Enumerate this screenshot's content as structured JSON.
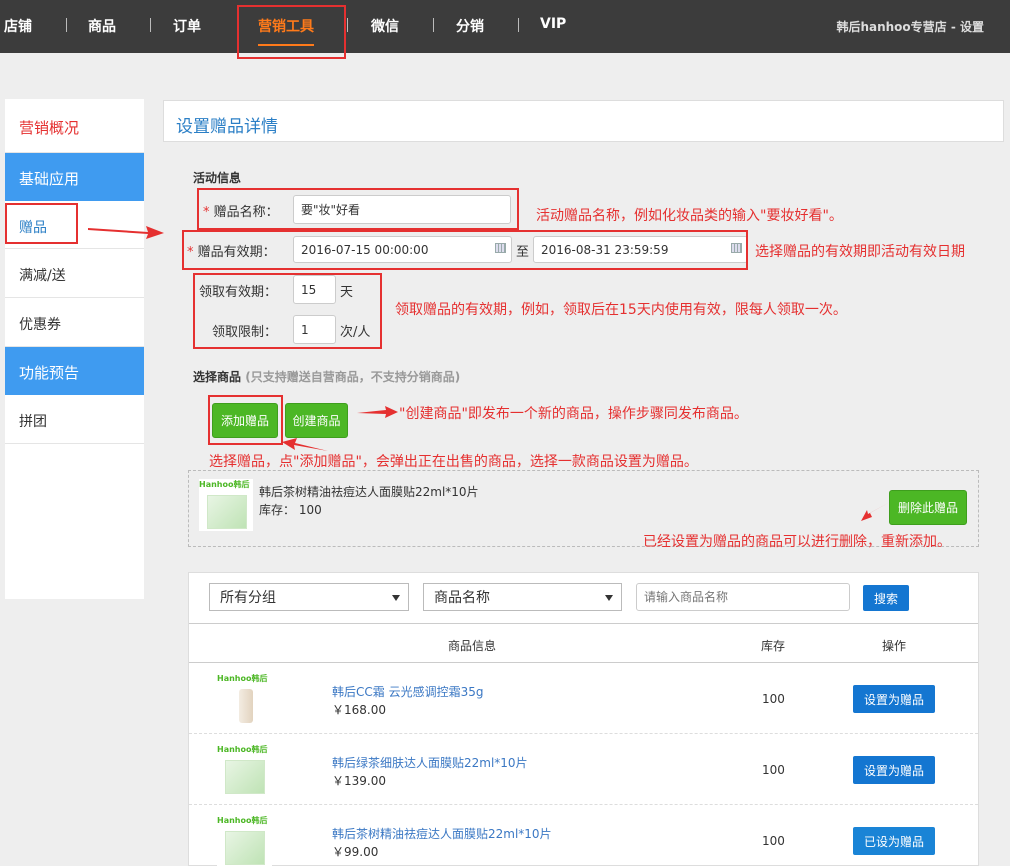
{
  "topnav": {
    "items": [
      "店铺",
      "商品",
      "订单",
      "营销工具",
      "微信",
      "分销",
      "VIP"
    ],
    "active": "营销工具",
    "store_info": "韩后hanhoo专营店 - 设置"
  },
  "sidebar": {
    "items": [
      "营销概况",
      "基础应用",
      "赠品",
      "满减/送",
      "优惠券",
      "功能预告",
      "拼团"
    ]
  },
  "page_title": "设置赠品详情",
  "activity": {
    "section_label": "活动信息",
    "gift_name_label": "赠品名称：",
    "gift_name_value": "要\"妆\"好看",
    "validity_label": "赠品有效期：",
    "start_date": "2016-07-15 00:00:00",
    "to": "至",
    "end_date": "2016-08-31 23:59:59",
    "claim_validity_label": "领取有效期：",
    "claim_validity_value": "15",
    "claim_validity_unit": "天",
    "claim_limit_label": "领取限制：",
    "claim_limit_value": "1",
    "claim_limit_unit": "次/人"
  },
  "select_goods": {
    "section_label": "选择商品",
    "hint": "(只支持赠送自营商品，不支持分销商品)",
    "add_button": "添加赠品",
    "create_button": "创建商品"
  },
  "selected_gift": {
    "name": "韩后茶树精油祛痘达人面膜贴22ml*10片",
    "stock_label": "库存：",
    "stock_value": "100",
    "delete_button": "删除此赠品",
    "brand": "Hanhoo韩后"
  },
  "annotations": {
    "a1": "活动赠品名称，例如化妆品类的输入\"要妆好看\"。",
    "a2": "选择赠品的有效期即活动有效日期",
    "a3": "领取赠品的有效期，例如，领取后在15天内使用有效，限每人领取一次。",
    "a4": "\"创建商品\"即发布一个新的商品，操作步骤同发布商品。",
    "a5": "选择赠品，点\"添加赠品\"，会弹出正在出售的商品，选择一款商品设置为赠品。",
    "a6": "已经设置为赠品的商品可以进行删除，重新添加。"
  },
  "filter": {
    "group_select": "所有分组",
    "field_select": "商品名称",
    "search_placeholder": "请输入商品名称",
    "search_button": "搜索"
  },
  "table": {
    "headers": [
      "商品信息",
      "库存",
      "操作"
    ],
    "rows": [
      {
        "name": "韩后CC霜 云光感调控霜35g",
        "price": "￥168.00",
        "stock": "100",
        "action": "设置为赠品",
        "brand": "Hanhoo韩后"
      },
      {
        "name": "韩后绿茶细肤达人面膜贴22ml*10片",
        "price": "￥139.00",
        "stock": "100",
        "action": "设置为赠品",
        "brand": "Hanhoo韩后"
      },
      {
        "name": "韩后茶树精油祛痘达人面膜贴22ml*10片",
        "price": "￥99.00",
        "stock": "100",
        "action": "已设为赠品",
        "brand": "Hanhoo韩后"
      }
    ]
  },
  "colors": {
    "topbar": "#3c3c3c",
    "accent_orange": "#ff7a1a",
    "sidebar_blue": "#3f9bf0",
    "green_button": "#4cb725",
    "blue_button": "#1476d1",
    "annotation_red": "#e53030"
  }
}
